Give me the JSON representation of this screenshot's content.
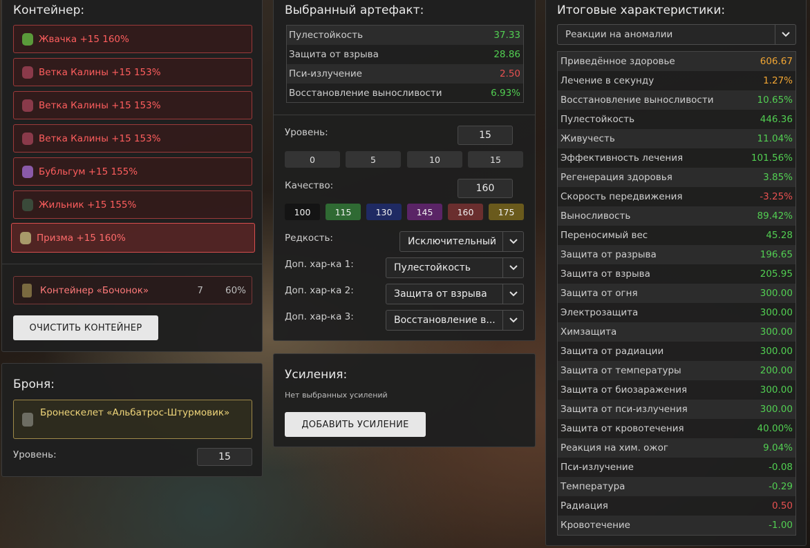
{
  "container": {
    "title": "Контейнер:",
    "artifacts": [
      {
        "label": "Жвачка +15 160%",
        "icon": "green-artifact-icon",
        "color": "#5a9a3a"
      },
      {
        "label": "Ветка Калины +15 153%",
        "icon": "berry-branch-icon",
        "color": "#8a3a4a"
      },
      {
        "label": "Ветка Калины +15 153%",
        "icon": "berry-branch-icon",
        "color": "#8a3a4a"
      },
      {
        "label": "Ветка Калины +15 153%",
        "icon": "berry-branch-icon",
        "color": "#8a3a4a"
      },
      {
        "label": "Бубльгум +15 155%",
        "icon": "purple-artifact-icon",
        "color": "#8a5aa8"
      },
      {
        "label": "Жильник +15 155%",
        "icon": "dark-artifact-icon",
        "color": "#3a4a3a"
      },
      {
        "label": "Призма +15 160%",
        "icon": "prism-artifact-icon",
        "color": "#a89a6a"
      }
    ],
    "selected_index": 6,
    "container_item": {
      "label": "Контейнер «Бочонок»",
      "slots": "7",
      "percent": "60%"
    },
    "clear_button": "ОЧИСТИТЬ КОНТЕЙНЕР"
  },
  "armor": {
    "title": "Броня:",
    "item": "Бронескелет «Альбатрос-Штурмовик»",
    "level_label": "Уровень:",
    "level_value": "15"
  },
  "artifact": {
    "title": "Выбранный артефакт:",
    "stats": [
      {
        "name": "Пулестойкость",
        "value": "37.33",
        "tone": "green"
      },
      {
        "name": "Защита от взрыва",
        "value": "28.86",
        "tone": "green"
      },
      {
        "name": "Пси-излучение",
        "value": "2.50",
        "tone": "red"
      },
      {
        "name": "Восстановление выносливости",
        "value": "6.93%",
        "tone": "green"
      }
    ],
    "level_label": "Уровень:",
    "level_value": "15",
    "level_presets": [
      "0",
      "5",
      "10",
      "15"
    ],
    "quality_label": "Качество:",
    "quality_value": "160",
    "quality_presets": [
      {
        "label": "100",
        "color": "#141414"
      },
      {
        "label": "115",
        "color": "#2f6a33"
      },
      {
        "label": "130",
        "color": "#1f2a63"
      },
      {
        "label": "145",
        "color": "#5a2466"
      },
      {
        "label": "160",
        "color": "#6a2e2e"
      },
      {
        "label": "175",
        "color": "#6a5a1c"
      }
    ],
    "rarity_label": "Редкость:",
    "rarity_value": "Исключительный",
    "extra1_label": "Доп. хар-ка 1:",
    "extra1_value": "Пулестойкость",
    "extra2_label": "Доп. хар-ка 2:",
    "extra2_value": "Защита от взрыва",
    "extra3_label": "Доп. хар-ка 3:",
    "extra3_value": "Восстановление в..."
  },
  "boosts": {
    "title": "Усиления:",
    "empty_text": "Нет выбранных усилений",
    "add_button": "ДОБАВИТЬ УСИЛЕНИЕ"
  },
  "totals": {
    "title": "Итоговые характеристики:",
    "filter_value": "Реакции на аномалии",
    "rows": [
      {
        "name": "Приведённое здоровье",
        "value": "606.67",
        "tone": "orange"
      },
      {
        "name": "Лечение в секунду",
        "value": "1.27%",
        "tone": "orange"
      },
      {
        "name": "Восстановление выносливости",
        "value": "10.65%",
        "tone": "green"
      },
      {
        "name": "Пулестойкость",
        "value": "446.36",
        "tone": "green"
      },
      {
        "name": "Живучесть",
        "value": "11.04%",
        "tone": "green"
      },
      {
        "name": "Эффективность лечения",
        "value": "101.56%",
        "tone": "green"
      },
      {
        "name": "Регенерация здоровья",
        "value": "3.85%",
        "tone": "green"
      },
      {
        "name": "Скорость передвижения",
        "value": "-3.25%",
        "tone": "red"
      },
      {
        "name": "Выносливость",
        "value": "89.42%",
        "tone": "green"
      },
      {
        "name": "Переносимый вес",
        "value": "45.28",
        "tone": "green"
      },
      {
        "name": "Защита от разрыва",
        "value": "196.65",
        "tone": "green"
      },
      {
        "name": "Защита от взрыва",
        "value": "205.95",
        "tone": "green"
      },
      {
        "name": "Защита от огня",
        "value": "300.00",
        "tone": "green"
      },
      {
        "name": "Электрозащита",
        "value": "300.00",
        "tone": "green"
      },
      {
        "name": "Химзащита",
        "value": "300.00",
        "tone": "green"
      },
      {
        "name": "Защита от радиации",
        "value": "300.00",
        "tone": "green"
      },
      {
        "name": "Защита от температуры",
        "value": "200.00",
        "tone": "green"
      },
      {
        "name": "Защита от биозаражения",
        "value": "300.00",
        "tone": "green"
      },
      {
        "name": "Защита от пси-излучения",
        "value": "300.00",
        "tone": "green"
      },
      {
        "name": "Защита от кровотечения",
        "value": "40.00%",
        "tone": "green"
      },
      {
        "name": "Реакция на хим. ожог",
        "value": "9.04%",
        "tone": "green"
      },
      {
        "name": "Пси-излучение",
        "value": "-0.08",
        "tone": "green"
      },
      {
        "name": "Температура",
        "value": "-0.29",
        "tone": "green"
      },
      {
        "name": "Радиация",
        "value": "0.50",
        "tone": "red"
      },
      {
        "name": "Кровотечение",
        "value": "-1.00",
        "tone": "green"
      }
    ]
  }
}
